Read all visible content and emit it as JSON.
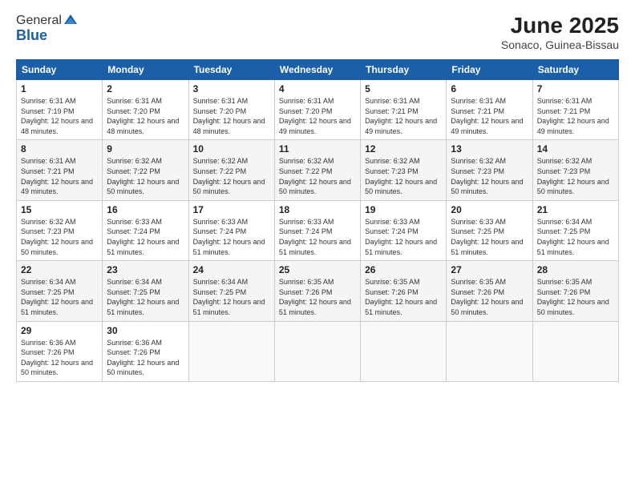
{
  "header": {
    "logo_line1": "General",
    "logo_line2": "Blue",
    "title": "June 2025",
    "subtitle": "Sonaco, Guinea-Bissau"
  },
  "weekdays": [
    "Sunday",
    "Monday",
    "Tuesday",
    "Wednesday",
    "Thursday",
    "Friday",
    "Saturday"
  ],
  "weeks": [
    [
      {
        "day": "1",
        "sunrise": "6:31 AM",
        "sunset": "7:19 PM",
        "daylight": "12 hours and 48 minutes."
      },
      {
        "day": "2",
        "sunrise": "6:31 AM",
        "sunset": "7:20 PM",
        "daylight": "12 hours and 48 minutes."
      },
      {
        "day": "3",
        "sunrise": "6:31 AM",
        "sunset": "7:20 PM",
        "daylight": "12 hours and 48 minutes."
      },
      {
        "day": "4",
        "sunrise": "6:31 AM",
        "sunset": "7:20 PM",
        "daylight": "12 hours and 49 minutes."
      },
      {
        "day": "5",
        "sunrise": "6:31 AM",
        "sunset": "7:21 PM",
        "daylight": "12 hours and 49 minutes."
      },
      {
        "day": "6",
        "sunrise": "6:31 AM",
        "sunset": "7:21 PM",
        "daylight": "12 hours and 49 minutes."
      },
      {
        "day": "7",
        "sunrise": "6:31 AM",
        "sunset": "7:21 PM",
        "daylight": "12 hours and 49 minutes."
      }
    ],
    [
      {
        "day": "8",
        "sunrise": "6:31 AM",
        "sunset": "7:21 PM",
        "daylight": "12 hours and 49 minutes."
      },
      {
        "day": "9",
        "sunrise": "6:32 AM",
        "sunset": "7:22 PM",
        "daylight": "12 hours and 50 minutes."
      },
      {
        "day": "10",
        "sunrise": "6:32 AM",
        "sunset": "7:22 PM",
        "daylight": "12 hours and 50 minutes."
      },
      {
        "day": "11",
        "sunrise": "6:32 AM",
        "sunset": "7:22 PM",
        "daylight": "12 hours and 50 minutes."
      },
      {
        "day": "12",
        "sunrise": "6:32 AM",
        "sunset": "7:23 PM",
        "daylight": "12 hours and 50 minutes."
      },
      {
        "day": "13",
        "sunrise": "6:32 AM",
        "sunset": "7:23 PM",
        "daylight": "12 hours and 50 minutes."
      },
      {
        "day": "14",
        "sunrise": "6:32 AM",
        "sunset": "7:23 PM",
        "daylight": "12 hours and 50 minutes."
      }
    ],
    [
      {
        "day": "15",
        "sunrise": "6:32 AM",
        "sunset": "7:23 PM",
        "daylight": "12 hours and 50 minutes."
      },
      {
        "day": "16",
        "sunrise": "6:33 AM",
        "sunset": "7:24 PM",
        "daylight": "12 hours and 51 minutes."
      },
      {
        "day": "17",
        "sunrise": "6:33 AM",
        "sunset": "7:24 PM",
        "daylight": "12 hours and 51 minutes."
      },
      {
        "day": "18",
        "sunrise": "6:33 AM",
        "sunset": "7:24 PM",
        "daylight": "12 hours and 51 minutes."
      },
      {
        "day": "19",
        "sunrise": "6:33 AM",
        "sunset": "7:24 PM",
        "daylight": "12 hours and 51 minutes."
      },
      {
        "day": "20",
        "sunrise": "6:33 AM",
        "sunset": "7:25 PM",
        "daylight": "12 hours and 51 minutes."
      },
      {
        "day": "21",
        "sunrise": "6:34 AM",
        "sunset": "7:25 PM",
        "daylight": "12 hours and 51 minutes."
      }
    ],
    [
      {
        "day": "22",
        "sunrise": "6:34 AM",
        "sunset": "7:25 PM",
        "daylight": "12 hours and 51 minutes."
      },
      {
        "day": "23",
        "sunrise": "6:34 AM",
        "sunset": "7:25 PM",
        "daylight": "12 hours and 51 minutes."
      },
      {
        "day": "24",
        "sunrise": "6:34 AM",
        "sunset": "7:25 PM",
        "daylight": "12 hours and 51 minutes."
      },
      {
        "day": "25",
        "sunrise": "6:35 AM",
        "sunset": "7:26 PM",
        "daylight": "12 hours and 51 minutes."
      },
      {
        "day": "26",
        "sunrise": "6:35 AM",
        "sunset": "7:26 PM",
        "daylight": "12 hours and 51 minutes."
      },
      {
        "day": "27",
        "sunrise": "6:35 AM",
        "sunset": "7:26 PM",
        "daylight": "12 hours and 50 minutes."
      },
      {
        "day": "28",
        "sunrise": "6:35 AM",
        "sunset": "7:26 PM",
        "daylight": "12 hours and 50 minutes."
      }
    ],
    [
      {
        "day": "29",
        "sunrise": "6:36 AM",
        "sunset": "7:26 PM",
        "daylight": "12 hours and 50 minutes."
      },
      {
        "day": "30",
        "sunrise": "6:36 AM",
        "sunset": "7:26 PM",
        "daylight": "12 hours and 50 minutes."
      },
      null,
      null,
      null,
      null,
      null
    ]
  ]
}
